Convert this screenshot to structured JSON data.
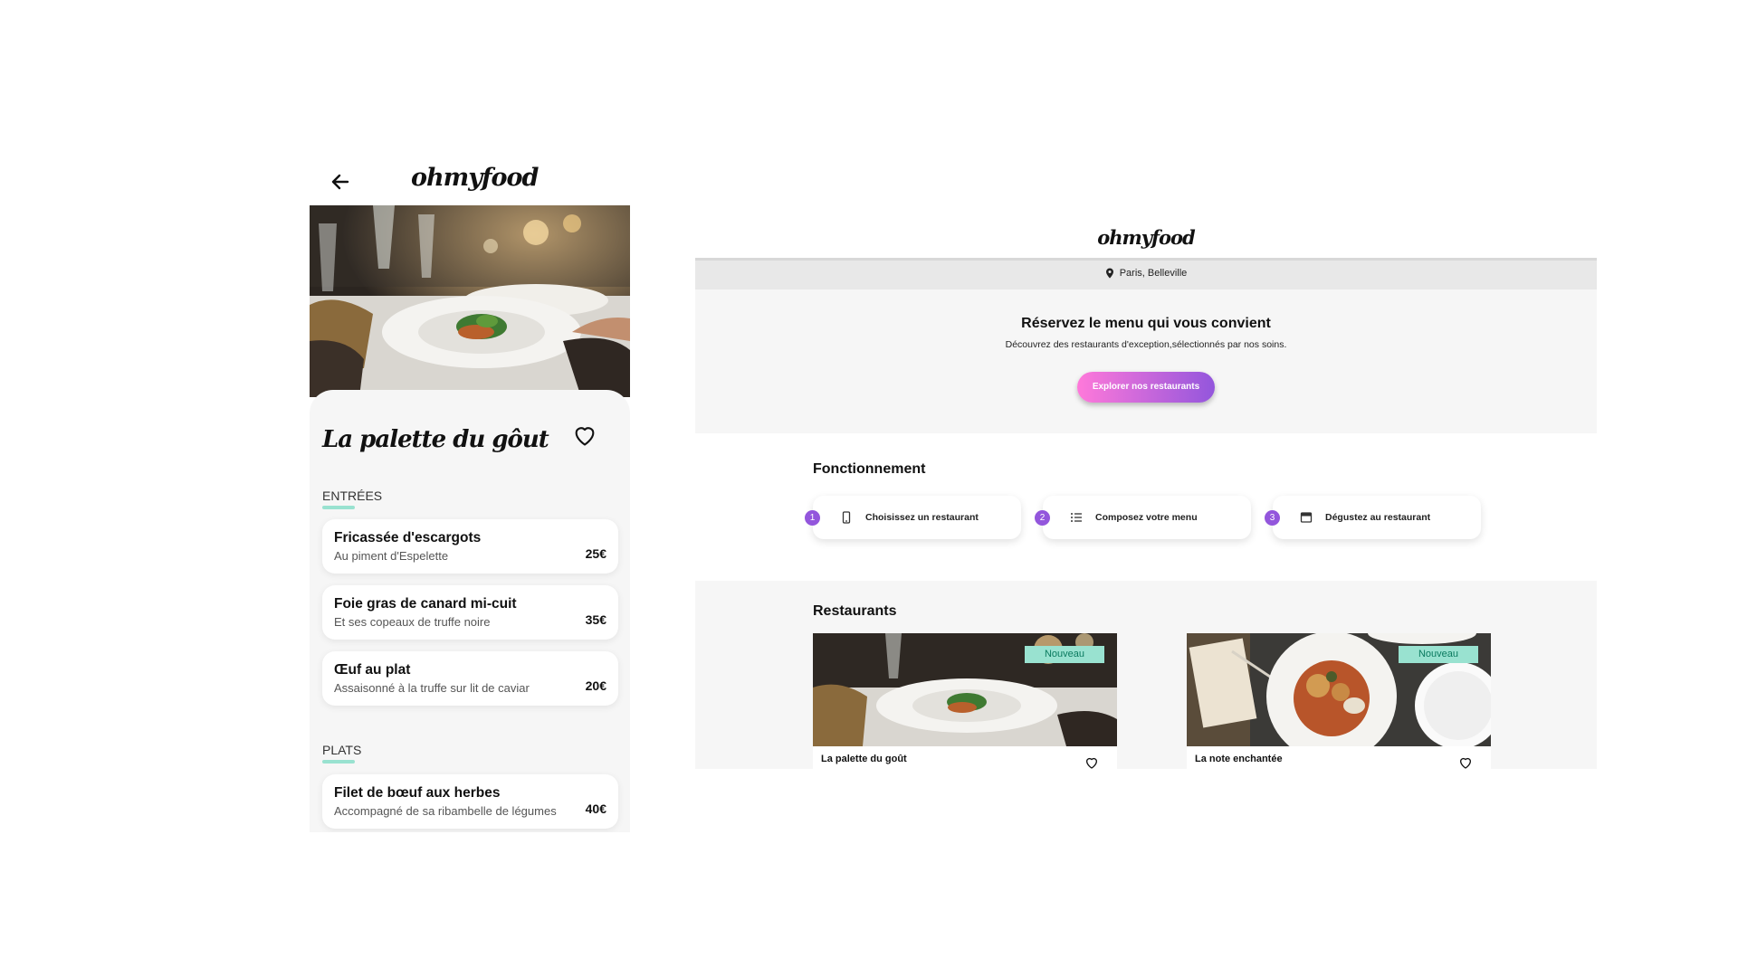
{
  "mobile": {
    "logo": "ohmyfood",
    "restaurant_title": "La palette du gôut",
    "sections": [
      {
        "title": "ENTRÉES",
        "items": [
          {
            "name": "Fricassée d'escargots",
            "desc": "Au piment d'Espelette",
            "price": "25€"
          },
          {
            "name": "Foie gras de canard mi-cuit",
            "desc": "Et ses copeaux de truffe noire",
            "price": "35€"
          },
          {
            "name": "Œuf au plat",
            "desc": "Assaisonné à la truffe sur lit de caviar",
            "price": "20€"
          }
        ]
      },
      {
        "title": "PLATS",
        "items": [
          {
            "name": "Filet de bœuf aux herbes",
            "desc": "Accompagné de sa ribambelle de légumes",
            "price": "40€"
          }
        ]
      }
    ]
  },
  "desktop": {
    "logo": "ohmyfood",
    "location": "Paris, Belleville",
    "hero_title": "Réservez le menu qui vous convient",
    "hero_subtitle": "Découvrez des restaurants d'exception,sélectionnés par nos soins.",
    "cta_label": "Explorer nos restaurants",
    "steps_title": "Fonctionnement",
    "steps": [
      {
        "num": "1",
        "label": "Choisissez un restaurant",
        "icon": "mobile-phone-icon"
      },
      {
        "num": "2",
        "label": "Composez votre menu",
        "icon": "list-icon"
      },
      {
        "num": "3",
        "label": "Dégustez au restaurant",
        "icon": "store-icon"
      }
    ],
    "restaurants_title": "Restaurants",
    "restaurants": [
      {
        "name": "La palette du goût",
        "badge": "Nouveau"
      },
      {
        "name": "La note enchantée",
        "badge": "Nouveau"
      }
    ]
  },
  "colors": {
    "accent_mint": "#99e2d0",
    "gradient_pink": "#ff79da",
    "gradient_purple": "#9356dc",
    "light_bg": "#f6f6f6"
  }
}
